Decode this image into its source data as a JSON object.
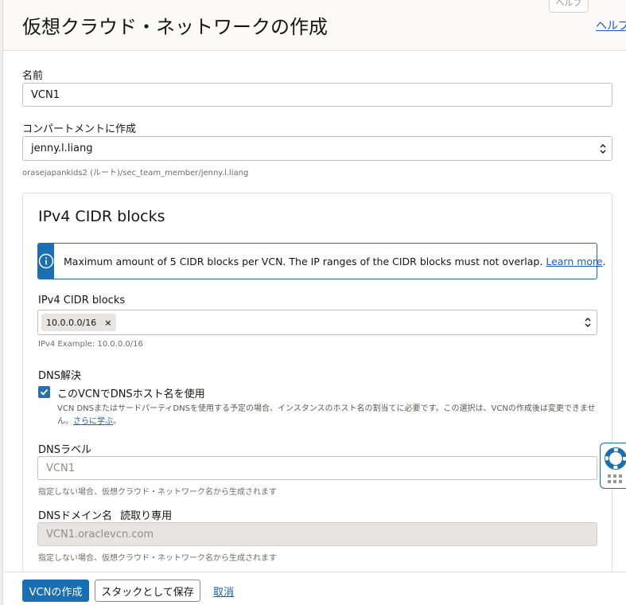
{
  "header": {
    "title": "仮想クラウド・ネットワークの作成",
    "help_link": "ヘルプ",
    "help_tab": "ヘルプ"
  },
  "form": {
    "name_label": "名前",
    "name_value": "VCN1",
    "compartment_label": "コンパートメントに作成",
    "compartment_value": "jenny.l.liang",
    "compartment_path": "orasejapankids2 (ルート)/sec_team_member/jenny.l.liang"
  },
  "cidr": {
    "section_title": "IPv4 CIDR blocks",
    "info_text": "Maximum amount of 5 CIDR blocks per VCN. The IP ranges of the CIDR blocks must not overlap.",
    "info_link": "Learn more",
    "info_link_suffix": ".",
    "field_label": "IPv4 CIDR blocks",
    "chips": [
      "10.0.0.0/16"
    ],
    "chip_remove": "×",
    "example": "IPv4 Example: 10.0.0.0/16"
  },
  "dns": {
    "resolution_label": "DNS解決",
    "checkbox_label": "このVCNでDNSホスト名を使用",
    "checkbox_checked": true,
    "checkbox_desc": "VCN DNSまたはサードパーティDNSを使用する予定の場合、インスタンスのホスト名の割当てに必要です。この選択は、VCNの作成後は変更できません。",
    "checkbox_desc_link": "さらに学ぶ",
    "checkbox_desc_suffix": "。",
    "label_label": "DNSラベル",
    "label_placeholder": "VCN1",
    "label_hint": "指定しない場合、仮想クラウド・ネットワーク名から生成されます",
    "domain_label": "DNSドメイン名",
    "domain_readonly": "読取り専用",
    "domain_value": "VCN1.oraclevcn.com",
    "domain_hint": "指定しない場合、仮想クラウド・ネットワーク名から生成されます"
  },
  "footer": {
    "create_button": "VCNの作成",
    "save_stack_button": "スタックとして保存",
    "cancel_link": "取消"
  },
  "colors": {
    "primary": "#1a6fb3",
    "link": "#1a5fb4"
  },
  "icons": {
    "info": "info-icon",
    "select_chevron": "chevron-up-down-icon",
    "checkbox": "check-icon",
    "help_widget": "lifebuoy-icon"
  }
}
